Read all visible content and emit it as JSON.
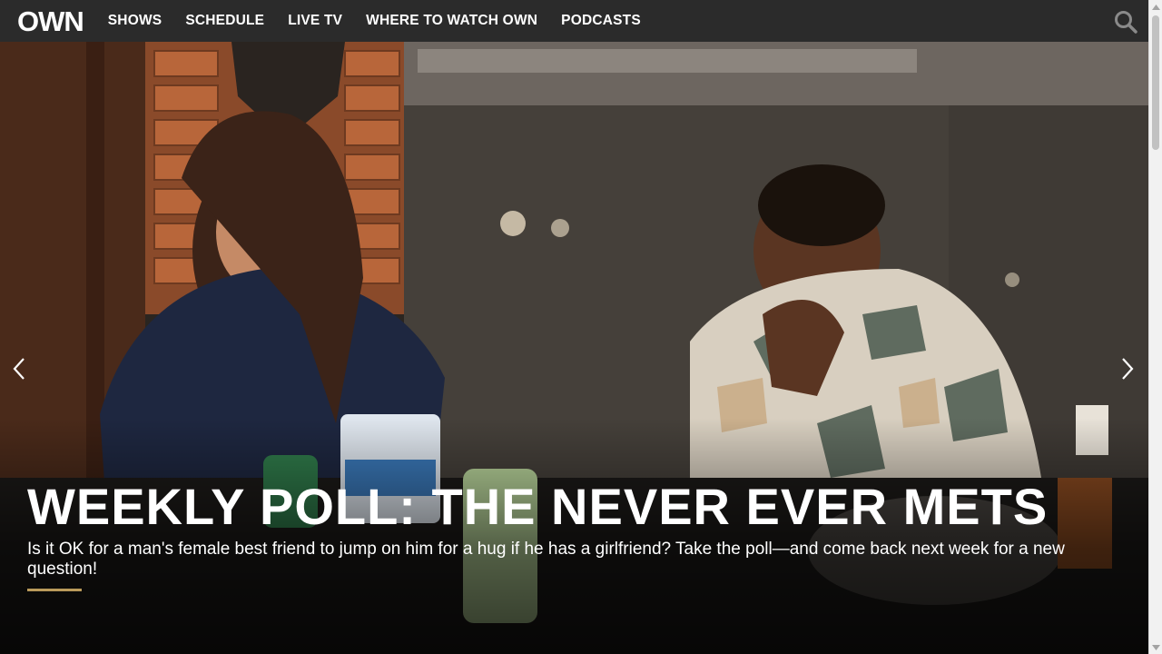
{
  "header": {
    "logo": "OWN",
    "nav": [
      {
        "label": "SHOWS"
      },
      {
        "label": "SCHEDULE"
      },
      {
        "label": "LIVE TV"
      },
      {
        "label": "WHERE TO WATCH OWN"
      },
      {
        "label": "PODCASTS"
      }
    ],
    "search_icon": "search-icon"
  },
  "hero": {
    "title": "WEEKLY POLL: THE NEVER EVER METS",
    "description": "Is it OK for a man's female best friend to jump on him for a hug if he has a girlfriend? Take the poll—and come back next week for a new question!",
    "more_label": "",
    "prev_icon": "chevron-left-icon",
    "next_icon": "chevron-right-icon"
  },
  "colors": {
    "nav_bg": "#2b2b2b",
    "accent": "#b99a5b",
    "text": "#ffffff"
  }
}
